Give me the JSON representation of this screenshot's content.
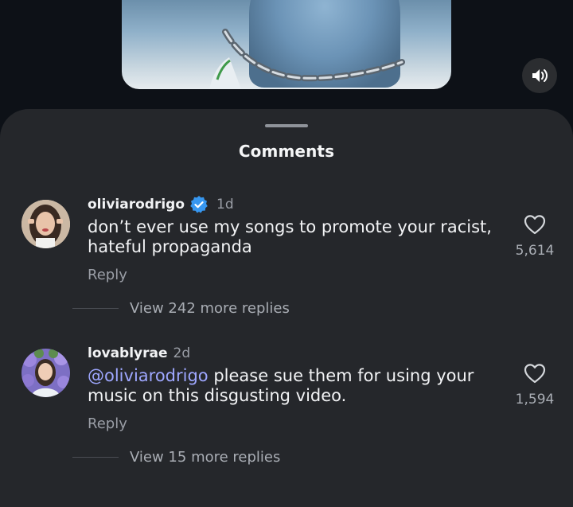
{
  "video": {
    "mute_icon": "speaker-icon"
  },
  "sheet": {
    "title": "Comments"
  },
  "comments": [
    {
      "username": "oliviarodrigo",
      "verified": true,
      "age": "1d",
      "mention": "",
      "text": "don’t ever use my songs to promote your racist, hateful propaganda",
      "reply_label": "Reply",
      "like_count": "5,614",
      "view_replies": "View 242 more replies"
    },
    {
      "username": "lovablyrae",
      "verified": false,
      "age": "2d",
      "mention": "@oliviarodrigo",
      "text": " please sue them for using your music on this disgusting video.",
      "reply_label": "Reply",
      "like_count": "1,594",
      "view_replies": "View 15 more replies"
    }
  ],
  "colors": {
    "background": "#0d1117",
    "sheet": "#25272b",
    "mention": "#9ea7ff",
    "verified": "#3797f0"
  }
}
